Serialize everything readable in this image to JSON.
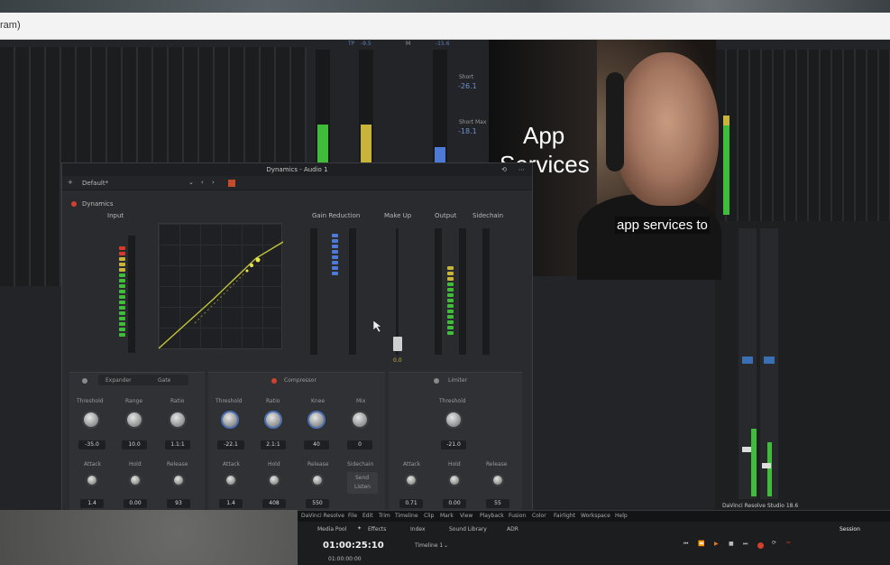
{
  "address_bar": {
    "text": "ram)"
  },
  "video": {
    "title_line1": "App",
    "title_line2": "Services",
    "caption": "app services to"
  },
  "background_meters": {
    "top_labels": [
      "TP",
      "-9.5",
      "M",
      "-15.6"
    ],
    "short_label": "Short",
    "short_value": "-26.1",
    "short_max_label": "Short Max",
    "short_max_value": "-18.1"
  },
  "dynamics": {
    "window_title": "Dynamics - Audio 1",
    "preset": "Default*",
    "section_label": "Dynamics",
    "columns": {
      "input": "Input",
      "gain_reduction": "Gain Reduction",
      "make_up": "Make Up",
      "output": "Output",
      "sidechain": "Sidechain"
    },
    "makeup_value": "0.0",
    "expander": {
      "tab_expander": "Expander",
      "tab_gate": "Gate",
      "threshold_label": "Threshold",
      "range_label": "Range",
      "ratio_label": "Ratio",
      "threshold_value": "-35.0",
      "range_value": "10.0",
      "ratio_value": "1.1:1",
      "attack_label": "Attack",
      "hold_label": "Hold",
      "release_label": "Release",
      "attack_value": "1.4",
      "hold_value": "0.00",
      "release_value": "93"
    },
    "compressor": {
      "title": "Compressor",
      "threshold_label": "Threshold",
      "ratio_label": "Ratio",
      "knee_label": "Knee",
      "mix_label": "Mix",
      "threshold_value": "-22.1",
      "ratio_value": "2.1:1",
      "knee_value": "40",
      "mix_value": "0",
      "attack_label": "Attack",
      "hold_label": "Hold",
      "release_label": "Release",
      "sidechain_label": "Sidechain",
      "attack_value": "1.4",
      "hold_value": "408",
      "release_value": "550",
      "send_listen": "Send",
      "listen": "Listen"
    },
    "limiter": {
      "title": "Limiter",
      "threshold_label": "Threshold",
      "threshold_value": "-21.0",
      "attack_label": "Attack",
      "hold_label": "Hold",
      "release_label": "Release",
      "attack_value": "0.71",
      "hold_value": "0.00",
      "release_value": "55"
    }
  },
  "transport": {
    "menu": [
      "DaVinci Resolve",
      "File",
      "Edit",
      "Trim",
      "Timeline",
      "Clip",
      "Mark",
      "View",
      "Playback",
      "Fusion",
      "Color",
      "Fairlight",
      "Workspace",
      "Help"
    ],
    "media_pool": "Media Pool",
    "effects": "Effects",
    "index": "Index",
    "sound_library": "Sound Library",
    "adr": "ADR",
    "session": "Session",
    "timecode": "01:00:25:10",
    "timeline": "Timeline 1",
    "small_timecode": "01:00:00:00"
  },
  "mixer_footer": "DaVinci Resolve Studio 18.6",
  "colors": {
    "meter_green": "#3fbd3a",
    "meter_yellow": "#c8b43a",
    "meter_red": "#d83a2a",
    "accent_blue": "#4c6fb0"
  }
}
